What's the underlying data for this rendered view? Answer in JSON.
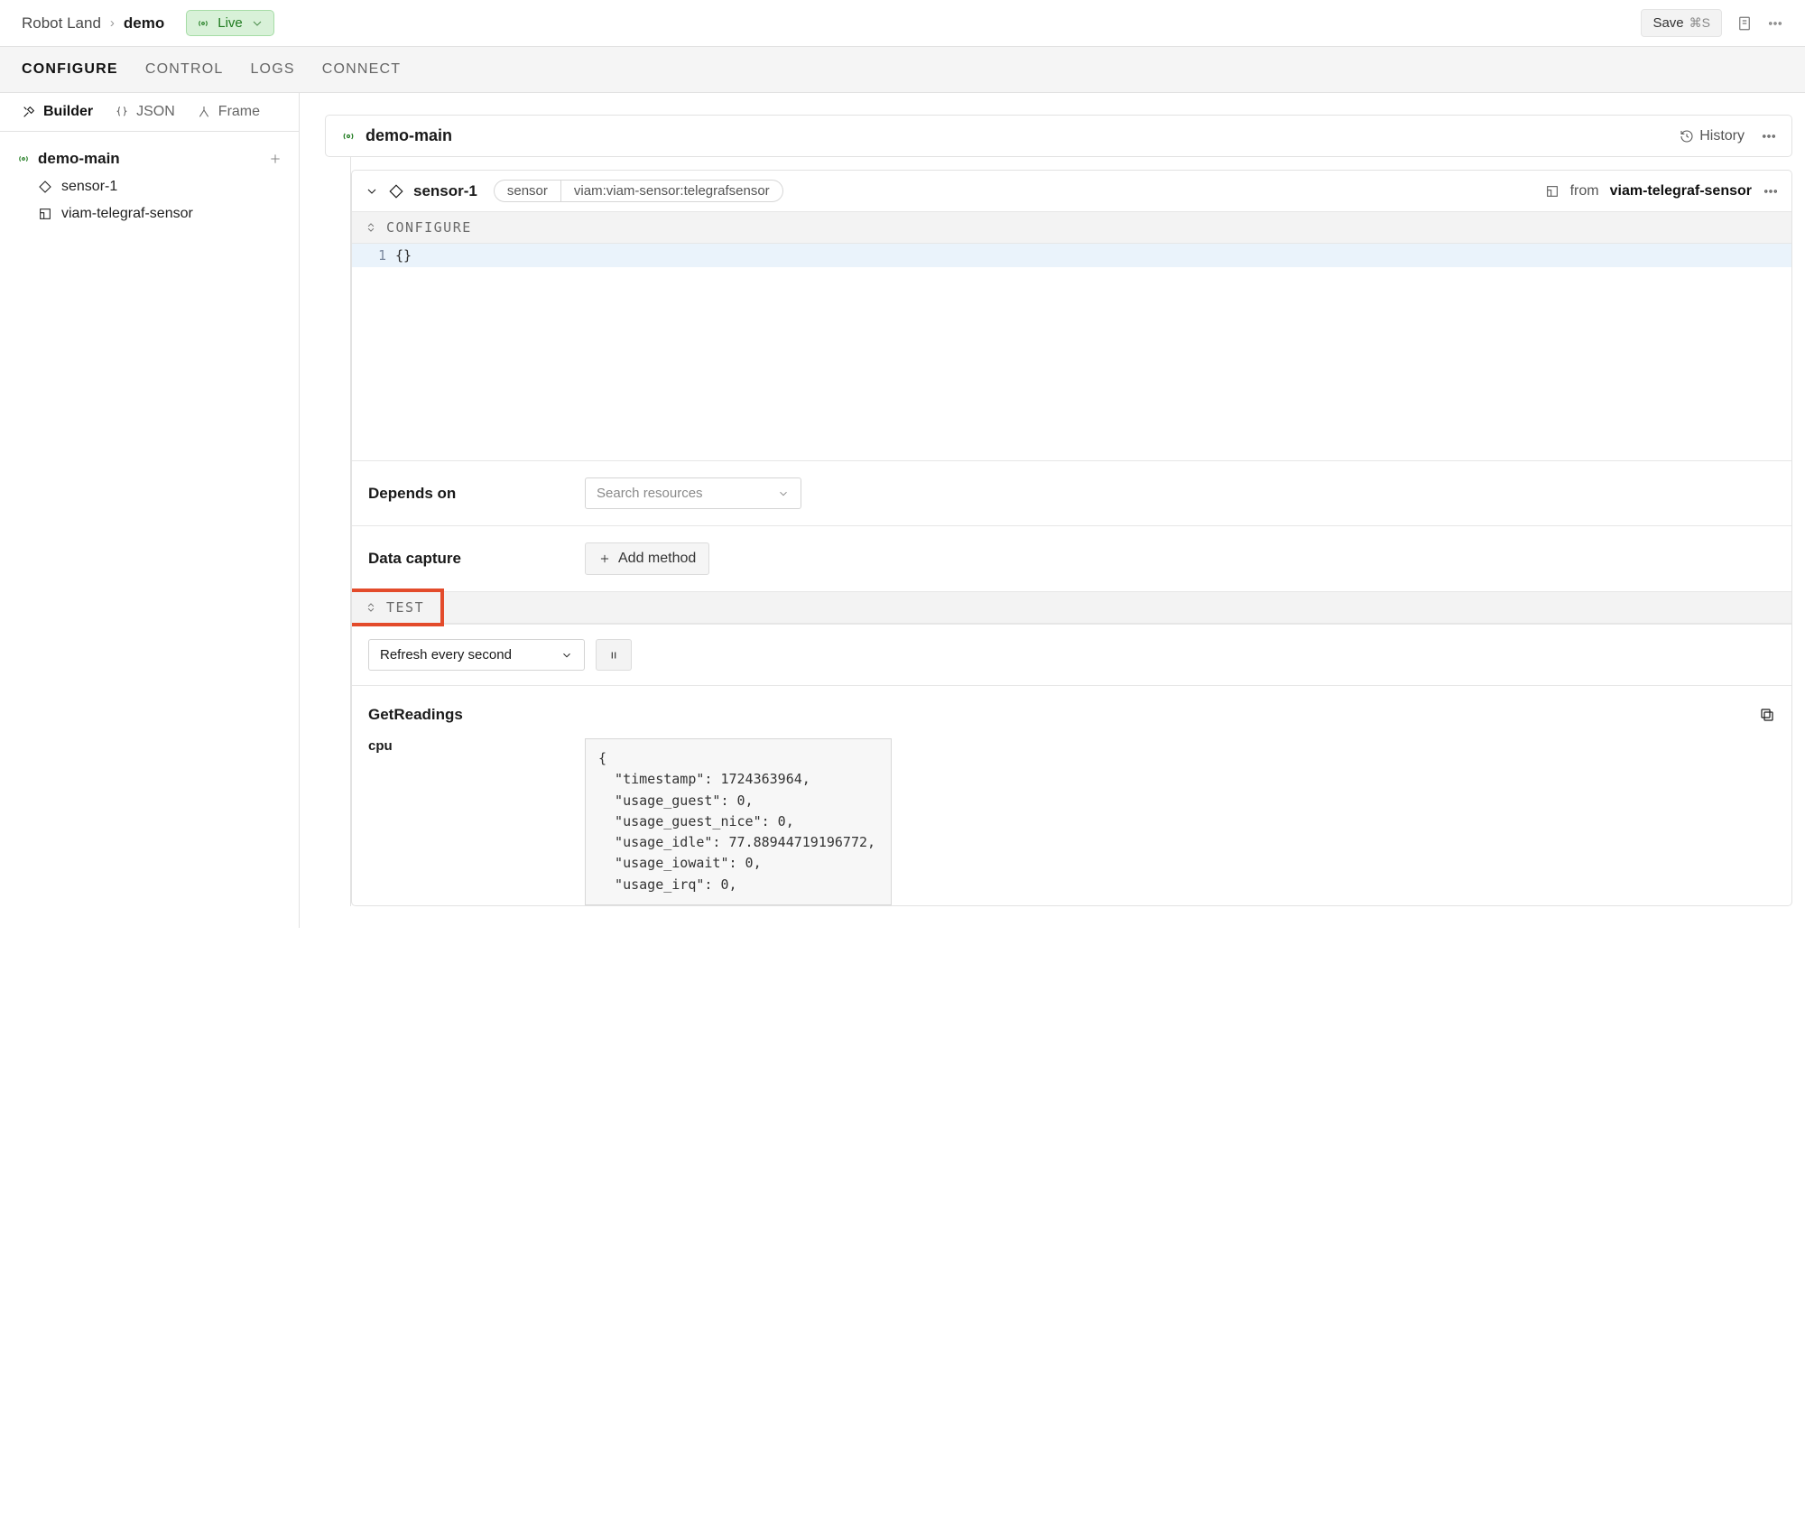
{
  "breadcrumb": {
    "org": "Robot Land",
    "project": "demo"
  },
  "live_label": "Live",
  "save_label": "Save",
  "save_kbd": "⌘S",
  "primary_tabs": [
    "CONFIGURE",
    "CONTROL",
    "LOGS",
    "CONNECT"
  ],
  "primary_active": 0,
  "side_tabs": [
    "Builder",
    "JSON",
    "Frame"
  ],
  "side_active": 0,
  "tree": {
    "root": "demo-main",
    "children": [
      {
        "label": "sensor-1"
      },
      {
        "label": "viam-telegraf-sensor"
      }
    ]
  },
  "main_header": {
    "title": "demo-main",
    "history_label": "History"
  },
  "resource": {
    "name": "sensor-1",
    "type": "sensor",
    "model": "viam:viam-sensor:telegrafsensor",
    "from_label": "from",
    "from_module": "viam-telegraf-sensor",
    "configure_label": "CONFIGURE",
    "code_line_no": "1",
    "code_text": "{}"
  },
  "depends": {
    "label": "Depends on",
    "search_placeholder": "Search resources"
  },
  "capture": {
    "label": "Data capture",
    "add_label": "Add method"
  },
  "test": {
    "label": "TEST",
    "refresh_label": "Refresh every second"
  },
  "readings": {
    "title": "GetReadings",
    "key": "cpu",
    "json": "{\n  \"timestamp\": 1724363964,\n  \"usage_guest\": 0,\n  \"usage_guest_nice\": 0,\n  \"usage_idle\": 77.88944719196772,\n  \"usage_iowait\": 0,\n  \"usage_irq\": 0,"
  }
}
